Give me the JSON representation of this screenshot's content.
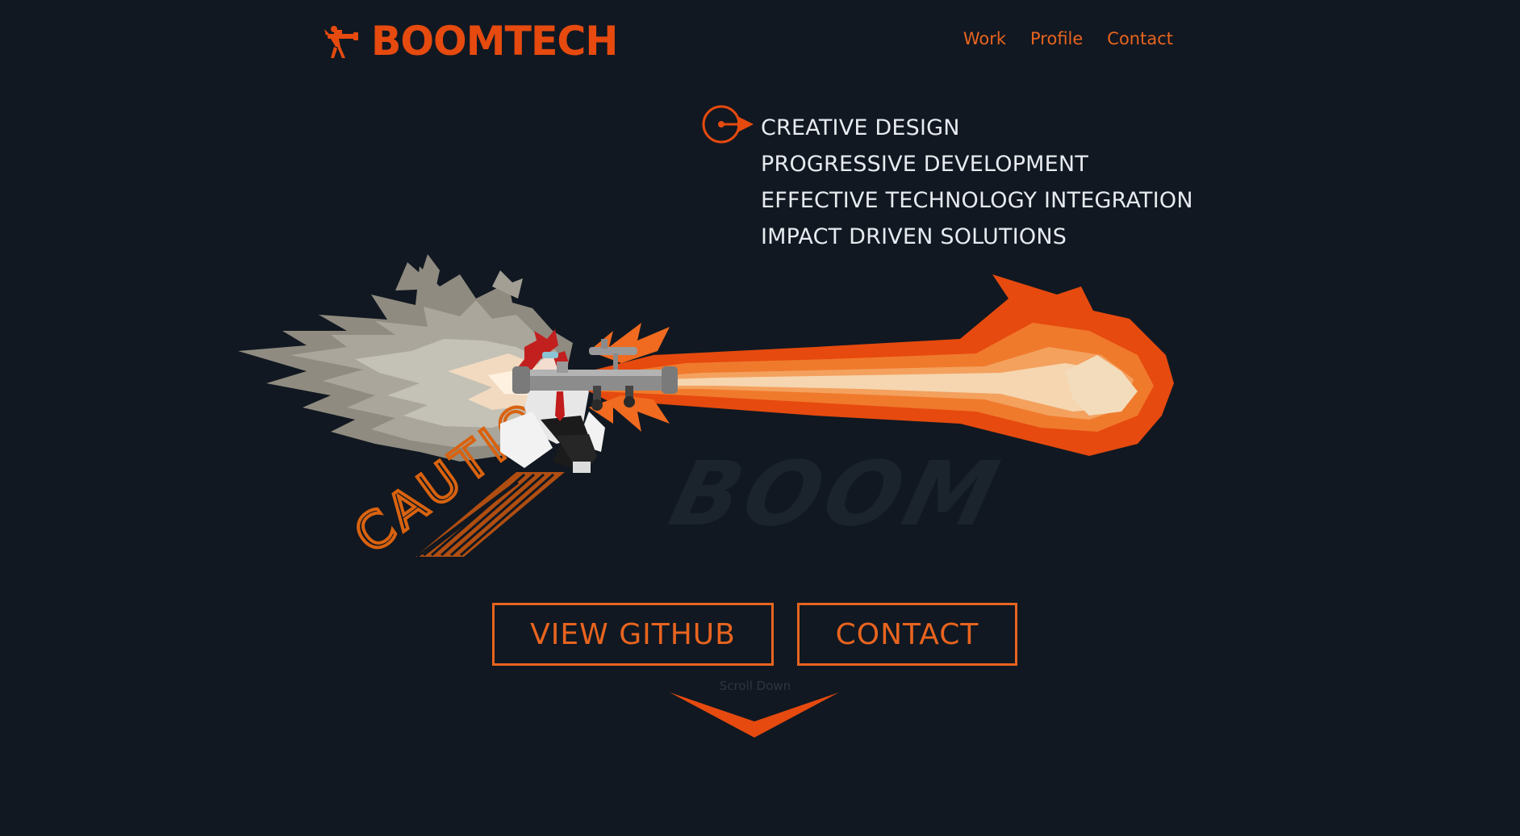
{
  "header": {
    "logo_text": "BOOMTECH",
    "logo_icon": "bazooka-soldier-icon"
  },
  "nav": {
    "items": [
      {
        "label": "Work"
      },
      {
        "label": "Profile"
      },
      {
        "label": "Contact"
      }
    ]
  },
  "hero": {
    "taglines": [
      "CREATIVE DESIGN",
      "PROGRESSIVE DEVELOPMENT",
      "EFFECTIVE TECHNOLOGY INTEGRATION",
      "IMPACT DRIVEN SOLUTIONS"
    ],
    "caution_text": "CAUTION",
    "watermark_text": "BOOM",
    "illustration": "character-firing-bazooka"
  },
  "actions": {
    "github_label": "VIEW GITHUB",
    "contact_label": "CONTACT"
  },
  "scroll": {
    "label": "Scroll Down"
  },
  "colors": {
    "background": "#111821",
    "accent": "#e8641f",
    "text": "#e7ebf0"
  }
}
